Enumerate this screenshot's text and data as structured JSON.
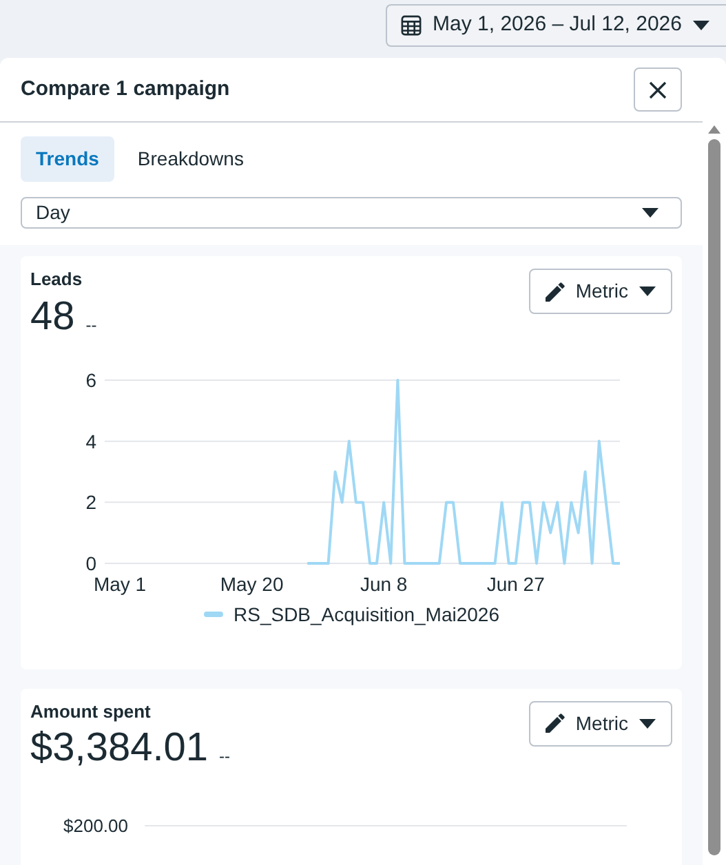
{
  "date_range": {
    "label": "May 1, 2026 – Jul 12, 2026"
  },
  "panel": {
    "title": "Compare 1 campaign"
  },
  "tabs": [
    {
      "label": "Trends",
      "selected": true
    },
    {
      "label": "Breakdowns",
      "selected": false
    }
  ],
  "granularity": {
    "value": "Day"
  },
  "cards": [
    {
      "title": "Leads",
      "value": "48",
      "change": "--",
      "button": "Metric",
      "chart_data": {
        "type": "line",
        "categories": [
          "May 1",
          null,
          null,
          null,
          null,
          null,
          null,
          null,
          null,
          null,
          null,
          null,
          null,
          null,
          null,
          null,
          null,
          null,
          null,
          "May 20",
          null,
          null,
          null,
          null,
          null,
          null,
          null,
          null,
          null,
          null,
          null,
          null,
          null,
          null,
          null,
          null,
          null,
          null,
          "Jun 8",
          null,
          null,
          null,
          null,
          null,
          null,
          null,
          null,
          null,
          null,
          null,
          null,
          null,
          null,
          null,
          null,
          null,
          null,
          "Jun 27",
          null,
          null,
          null,
          null,
          null,
          null,
          null,
          null,
          null,
          null,
          null,
          null,
          null,
          null,
          null
        ],
        "yticks": [
          0,
          2,
          4,
          6
        ],
        "ylim": [
          0,
          6
        ],
        "series": [
          {
            "name": "RS_SDB_Acquisition_Mai2026",
            "color": "#9fd8f5",
            "values": [
              null,
              null,
              null,
              null,
              null,
              null,
              null,
              null,
              null,
              null,
              null,
              null,
              null,
              null,
              null,
              null,
              null,
              null,
              null,
              null,
              null,
              null,
              null,
              null,
              null,
              null,
              null,
              0,
              0,
              0,
              0,
              3,
              2,
              4,
              2,
              2,
              0,
              0,
              2,
              0,
              6,
              0,
              0,
              0,
              0,
              0,
              0,
              2,
              2,
              0,
              0,
              0,
              0,
              0,
              0,
              2,
              0,
              0,
              2,
              2,
              0,
              2,
              1,
              2,
              0,
              2,
              1,
              3,
              0,
              4,
              2,
              0,
              0
            ]
          }
        ]
      }
    },
    {
      "title": "Amount spent",
      "value": "$3,384.01",
      "change": "--",
      "button": "Metric",
      "axis_labels": [
        "$200.00"
      ]
    }
  ]
}
